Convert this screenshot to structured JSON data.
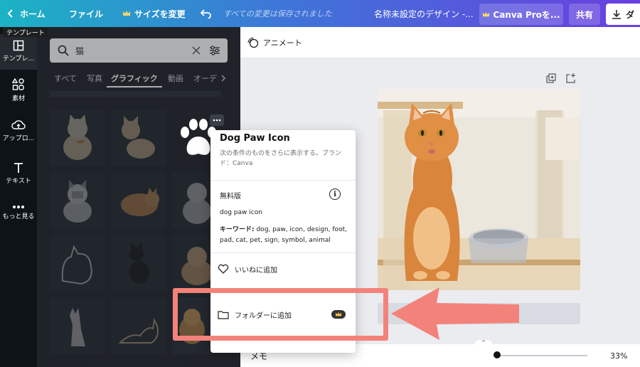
{
  "topbar": {
    "home_label": "ホーム",
    "file_label": "ファイル",
    "resize_label": "サイズを変更",
    "saved_status": "すべての変更は保存されました",
    "design_title": "名称未設定のデザイン -...",
    "pro_button": "Canva Proを...",
    "share_button": "共有",
    "download_button": "ダ"
  },
  "tooltip": "テンプレート",
  "rail": {
    "items": [
      {
        "label": "テンプレ...",
        "icon": "template-icon"
      },
      {
        "label": "素材",
        "icon": "elements-icon"
      },
      {
        "label": "アップロ...",
        "icon": "upload-icon"
      },
      {
        "label": "テキスト",
        "icon": "text-icon"
      },
      {
        "label": "もっと見る",
        "icon": "more-icon"
      }
    ]
  },
  "panel": {
    "search_value": "猫",
    "tabs": [
      {
        "label": "すべて"
      },
      {
        "label": "写真"
      },
      {
        "label": "グラフィック"
      },
      {
        "label": "動画"
      },
      {
        "label": "オーデ"
      }
    ],
    "active_tab": "グラフィック"
  },
  "canvas": {
    "animate_label": "アニメート",
    "memo_label": "メモ",
    "zoom": "33%",
    "zoom_fraction": 0.0
  },
  "popup": {
    "title": "Dog Paw Icon",
    "description": "次の条件のものをさらに表示する。ブランド：Canva",
    "license": "無料版",
    "item_name": "dog paw icon",
    "keywords_label": "キーワード:",
    "keywords": " dog, paw, icon, design, foot, pad, cat, pet, sign, symbol, animal",
    "like_label": "いいねに追加",
    "folder_label": "フォルダーに追加"
  },
  "colors": {
    "highlight": "#f3837a",
    "accent_start": "#1bb3c4",
    "accent_end": "#6a3fe0"
  }
}
